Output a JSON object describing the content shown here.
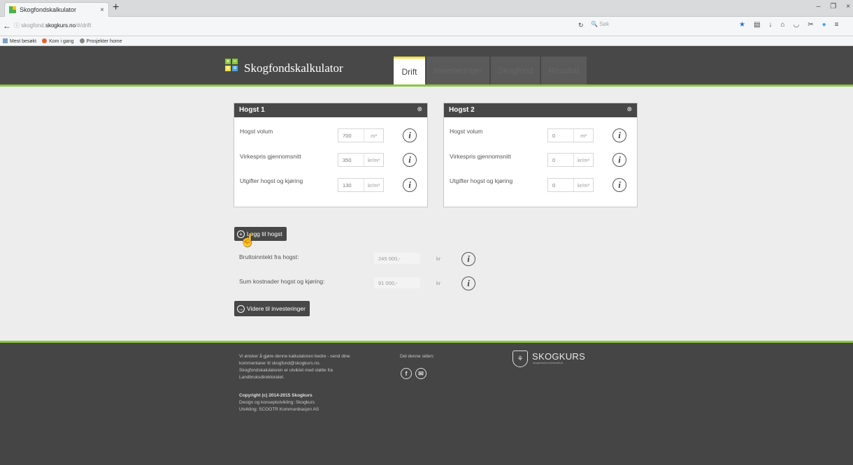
{
  "browser": {
    "tab_title": "Skogfondskalkulator",
    "tab_close": "×",
    "new_tab": "+",
    "url_prefix": "skogfond.",
    "url_host": "skogkurs.no",
    "url_path": "/#/drift",
    "search_placeholder": "Søk",
    "window_controls": [
      "–",
      "❐",
      "×"
    ],
    "bookmarks": [
      "Mest besøkt",
      "Kom i gang",
      "Prosjekter home"
    ]
  },
  "header": {
    "title": "Skogfondskalkulator",
    "logo_glyphs": [
      "+",
      "–",
      "×",
      "="
    ],
    "logo_colors": [
      "#8bc53f",
      "#8bc53f",
      "#f6e042",
      "#4aa3df"
    ],
    "tabs": [
      {
        "label": "Drift",
        "active": true
      },
      {
        "label": "Investeringer",
        "active": false
      },
      {
        "label": "Skogfond",
        "active": false
      },
      {
        "label": "Resultat",
        "active": false
      }
    ],
    "accent": "#8bc53f",
    "active_tab_color": "#f6e042"
  },
  "hogst1": {
    "title": "Hogst 1",
    "close": "⊗",
    "rows": [
      {
        "label": "Hogst volum",
        "value": "700",
        "unit": "m³"
      },
      {
        "label": "Virkespris gjennomsnitt",
        "value": "350",
        "unit": "kr/m³"
      },
      {
        "label": "Utgifter hogst og kjøring",
        "value": "130",
        "unit": "kr/m³"
      }
    ]
  },
  "hogst2": {
    "title": "Hogst 2",
    "close": "⊗",
    "rows": [
      {
        "label": "Hogst volum",
        "value": "0",
        "unit": "m³"
      },
      {
        "label": "Virkespris gjennomsnitt",
        "value": "0",
        "unit": "kr/m³"
      },
      {
        "label": "Utgifter hogst og kjøring",
        "value": "0",
        "unit": "kr/m³"
      }
    ]
  },
  "info_glyph": "i",
  "add_button": {
    "icon": "+",
    "label": "Legg til hogst"
  },
  "summary": [
    {
      "label": "Bruttoinntekt fra hogst:",
      "value": "245 000,-",
      "unit": "kr"
    },
    {
      "label": "Sum kostnader hogst og kjøring:",
      "value": "91 000,-",
      "unit": "kr"
    }
  ],
  "next_button": {
    "icon": "→",
    "label": "Videre til investeringer"
  },
  "footer": {
    "text_lines": [
      "Vi ønsker å gjøre denne kalkulatoren bedre - send dine",
      "kommentarer til skogfond@skogkurs.no.",
      "Skogfondskalulatoren er utviklet med støtte fra",
      "Landbruksdirektoratet."
    ],
    "copyright": "Copyright (c) 2014-2015 Skogkurs",
    "credits": [
      "Design og konseptutvikling: Skogkurs",
      "Utvikling: SCOOTR Kommunikasjon AS"
    ],
    "share_label": "Del denne siden:",
    "social": [
      "f",
      "✉"
    ],
    "brand": "SKOGKURS",
    "brand_sub": "skogbrukets kursinstitutt"
  }
}
